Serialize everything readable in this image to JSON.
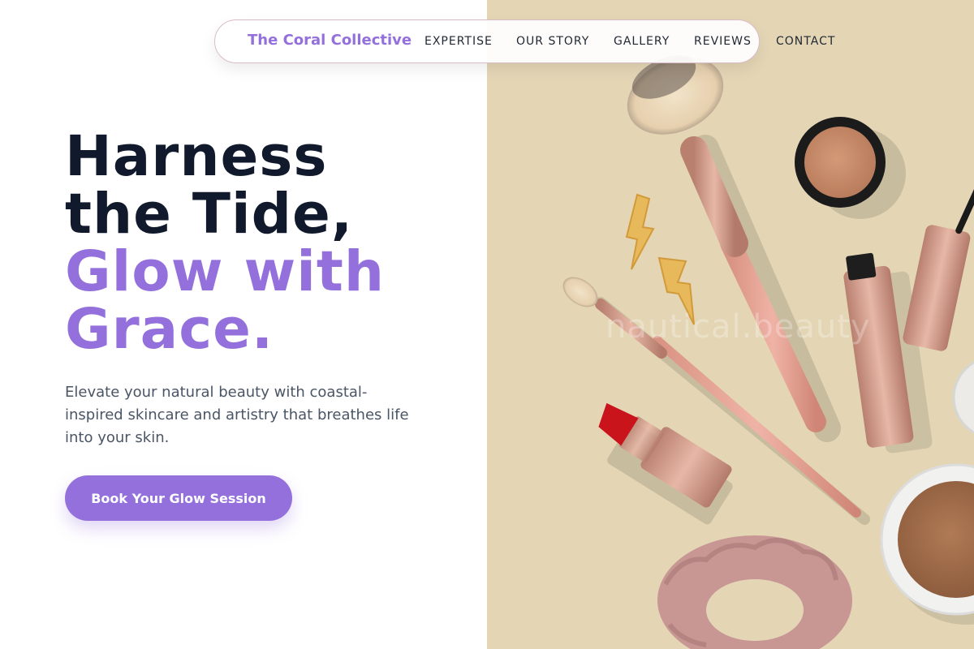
{
  "brand": {
    "name": "The Coral Collective"
  },
  "nav": {
    "links": [
      "EXPERTISE",
      "OUR STORY",
      "GALLERY",
      "REVIEWS",
      "CONTACT"
    ]
  },
  "hero": {
    "headline_line1": "Harness",
    "headline_line2": "the Tide,",
    "headline_line3": "Glow with",
    "headline_line4": "Grace.",
    "subtitle": "Elevate your natural beauty with coastal-inspired skincare and artistry that breathes life into your skin.",
    "cta_label": "Book Your Glow Session",
    "image_watermark": "nautical.beauty"
  },
  "colors": {
    "accent": "#9370db",
    "headline_dark": "#111a2c",
    "image_background": "#e4d6b5"
  }
}
